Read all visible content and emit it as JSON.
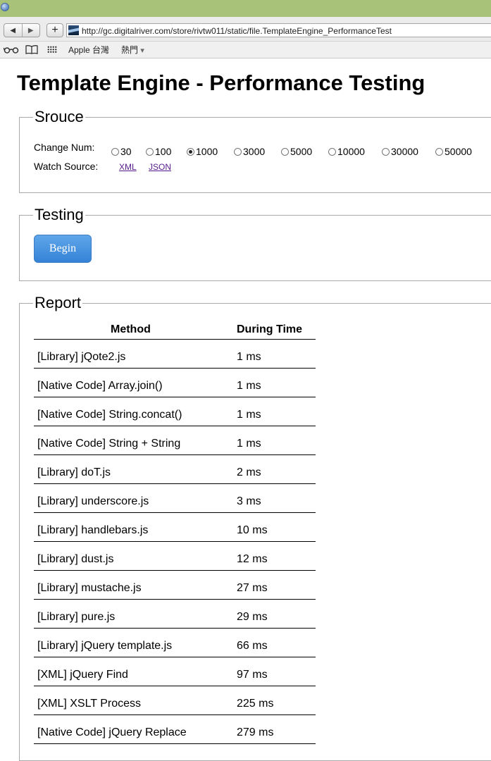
{
  "browser": {
    "url": "http://gc.digitalriver.com/store/rivtw011/static/file.TemplateEngine_PerformanceTest",
    "nav_back": "◀",
    "nav_forward": "▶",
    "new_tab": "+",
    "bookmarks": {
      "reading_list_icon": "glasses-icon",
      "bookmarks_icon": "book-icon",
      "top_sites_icon": "grid-icon",
      "item1": "Apple 台灣",
      "item2": "熱門",
      "item2_caret": "▾"
    }
  },
  "page": {
    "title": "Template Engine - Performance Testing"
  },
  "source": {
    "legend": "Srouce",
    "change_label": "Change Num:",
    "options": [
      "30",
      "100",
      "1000",
      "3000",
      "5000",
      "10000",
      "30000",
      "50000"
    ],
    "selected": "1000",
    "watch_label": "Watch Source:",
    "links": [
      "XML",
      "JSON"
    ]
  },
  "testing": {
    "legend": "Testing",
    "button": "Begin"
  },
  "report": {
    "legend": "Report",
    "headers": [
      "Method",
      "During Time"
    ],
    "rows": [
      [
        "[Library] jQote2.js",
        "1 ms"
      ],
      [
        "[Native Code] Array.join()",
        "1 ms"
      ],
      [
        "[Native Code] String.concat()",
        "1 ms"
      ],
      [
        "[Native Code] String + String",
        "1 ms"
      ],
      [
        "[Library] doT.js",
        "2 ms"
      ],
      [
        "[Library] underscore.js",
        "3 ms"
      ],
      [
        "[Library] handlebars.js",
        "10 ms"
      ],
      [
        "[Library] dust.js",
        "12 ms"
      ],
      [
        "[Library] mustache.js",
        "27 ms"
      ],
      [
        "[Library] pure.js",
        "29 ms"
      ],
      [
        "[Library] jQuery template.js",
        "66 ms"
      ],
      [
        "[XML] jQuery Find",
        "97 ms"
      ],
      [
        "[XML] XSLT Process",
        "225 ms"
      ],
      [
        "[Native Code] jQuery Replace",
        "279 ms"
      ]
    ]
  }
}
